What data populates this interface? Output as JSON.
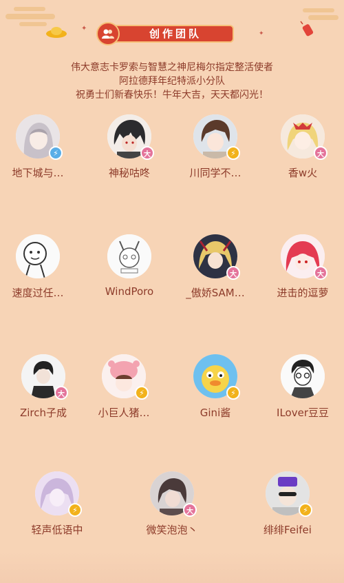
{
  "header": {
    "title": "创作团队",
    "taglines": [
      "伟大意志卡罗索与智慧之神尼梅尔指定整活使者",
      "阿拉德拜年纪特派小分队",
      "祝勇士们新春快乐！牛年大吉，天天都闪光！"
    ]
  },
  "badge_colors": {
    "bolt": "#f2b21b",
    "da": "#e4739a",
    "blue": "#5aaee7"
  },
  "members": [
    {
      "name": "地下城与…",
      "badge": "blue"
    },
    {
      "name": "神秘咕咚",
      "badge": "da"
    },
    {
      "name": "川同学不…",
      "badge": "bolt"
    },
    {
      "name": "香w火",
      "badge": "da"
    },
    {
      "name": "速度过任…",
      "badge": "none"
    },
    {
      "name": "WindPoro",
      "badge": "none"
    },
    {
      "name": "_傲娇SAM…",
      "badge": "da"
    },
    {
      "name": "进击的逗萝",
      "badge": "da"
    },
    {
      "name": "Zirch子成",
      "badge": "da"
    },
    {
      "name": "小巨人猪…",
      "badge": "bolt"
    },
    {
      "name": "Gini酱",
      "badge": "bolt"
    },
    {
      "name": "ILover豆豆",
      "badge": "none"
    },
    {
      "name": "轻声低语中",
      "badge": "bolt"
    },
    {
      "name": "微笑泡泡丶",
      "badge": "da"
    },
    {
      "name": "绯绯Feifei",
      "badge": "bolt"
    }
  ]
}
